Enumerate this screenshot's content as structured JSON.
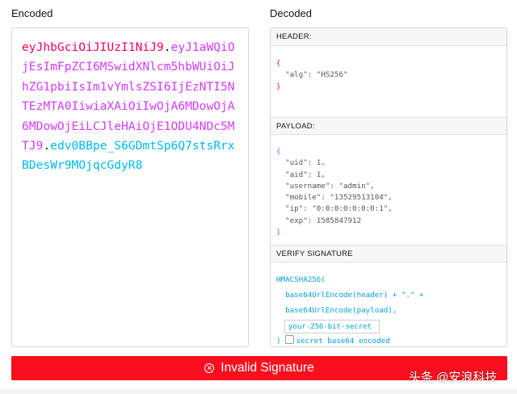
{
  "encoded": {
    "title": "Encoded",
    "token_header": "eyJhbGciOiJIUzI1NiJ9",
    "token_payload": "eyJ1aWQiOjEsImFpZCI6MSwidXNlcm5hbWUiOiJhZG1pbiIsIm1vYmlsZSI6IjEzNTI5NTEzMTA0IiwiaXAiOiIwOjA6MDowOjA6MDowOjEiLCJleHAiOjE1ODU4NDc5MTJ9",
    "token_signature": "edv0BBpe_S6GDmtSp6Q7stsRrxBDesWr9MOjqcGdyR8",
    "dot": "."
  },
  "decoded": {
    "title": "Decoded",
    "header_label": "HEADER:",
    "payload_label": "PAYLOAD:",
    "verify_label": "VERIFY SIGNATURE",
    "header_json": {
      "open": "{",
      "alg_line": "  \"alg\": \"HS256\"",
      "close": "}"
    },
    "payload_json": {
      "open": "{",
      "lines": [
        "  \"uid\": 1,",
        "  \"aid\": 1,",
        "  \"username\": \"admin\",",
        "  \"mobile\": \"13529513104\",",
        "  \"ip\": \"0:0:0:0:0:0:0:1\",",
        "  \"exp\": 1585847912"
      ],
      "close": "}"
    },
    "verify": {
      "line1": "HMACSHA256(",
      "line2": "  base64UrlEncode(header) + \".\" +",
      "line3": "  base64UrlEncode(payload),",
      "secret_placeholder": "your-256-bit-secret",
      "close_paren": ")",
      "checkbox_label": "secret base64 encoded",
      "checkbox_checked": false
    }
  },
  "status": {
    "text": "Invalid Signature",
    "icon": "x-circle-icon",
    "color": "#fb0f1f"
  },
  "watermark": {
    "text": "头条 @安浪科技"
  },
  "colors": {
    "header": "#fb015b",
    "payload": "#d63aff",
    "signature": "#00b9f1"
  }
}
